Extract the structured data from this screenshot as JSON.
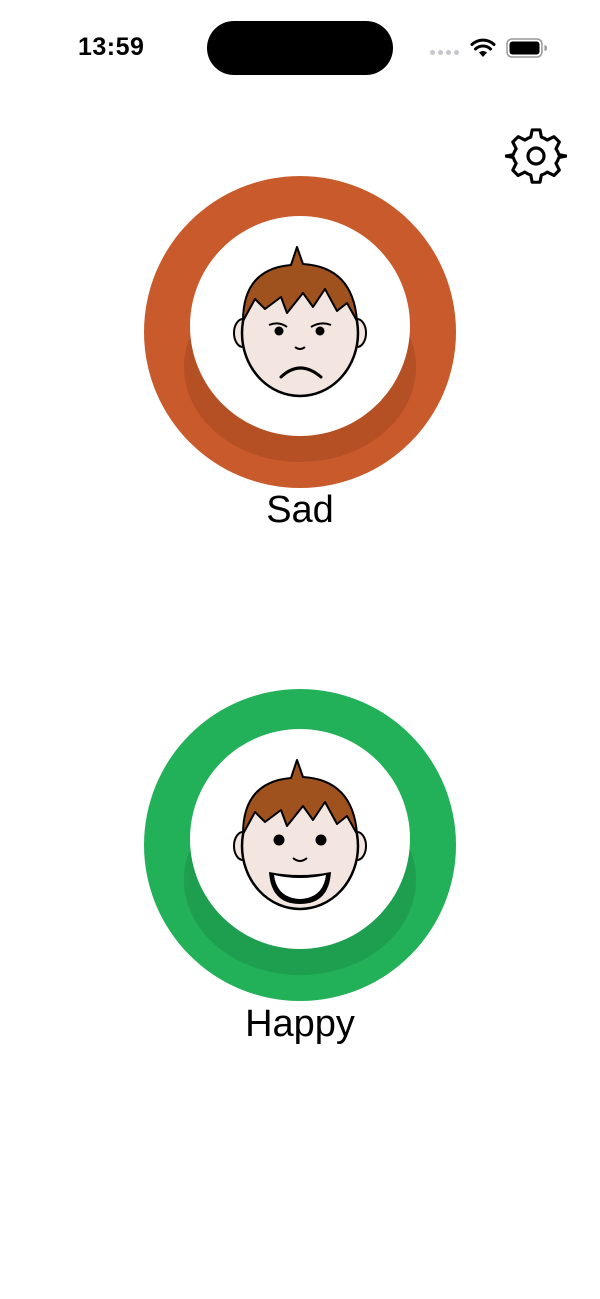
{
  "status_bar": {
    "time": "13:59",
    "icons": [
      "signal-dots-icon",
      "wifi-icon",
      "battery-icon"
    ]
  },
  "settings": {
    "icon": "gear-icon"
  },
  "moods": [
    {
      "label": "Sad",
      "icon": "sad-face-icon",
      "color": "#c85a2b"
    },
    {
      "label": "Happy",
      "icon": "happy-face-icon",
      "color": "#22b058"
    }
  ]
}
